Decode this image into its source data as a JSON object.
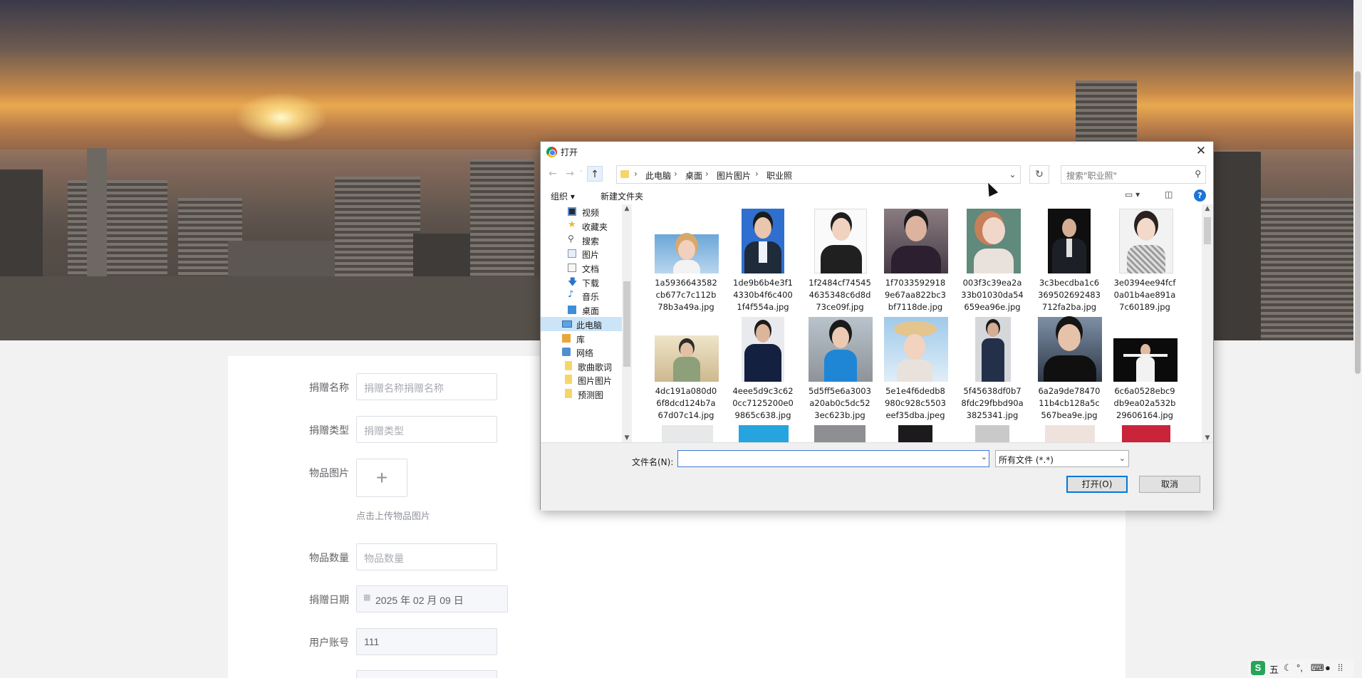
{
  "form": {
    "donation_name": {
      "label": "捐赠名称",
      "placeholder": "捐赠名称捐赠名称"
    },
    "donation_type": {
      "label": "捐赠类型",
      "placeholder": "捐赠类型"
    },
    "item_image": {
      "label": "物品图片",
      "hint": "点击上传物品图片",
      "plus": "+"
    },
    "item_quantity": {
      "label": "物品数量",
      "placeholder": "物品数量"
    },
    "donation_date": {
      "label": "捐赠日期",
      "value": "2025 年 02 月 09 日"
    },
    "user_account": {
      "label": "用户账号",
      "value": "111"
    }
  },
  "dialog": {
    "title": "打开",
    "close": "✕",
    "breadcrumb": [
      "此电脑",
      "桌面",
      "图片图片",
      "职业照"
    ],
    "search_placeholder": "搜索\"职业照\"",
    "toolbar": {
      "organize": "组织 ▾",
      "new_folder": "新建文件夹"
    },
    "tree": [
      {
        "label": "视频",
        "icon": "video-icon"
      },
      {
        "label": "收藏夹",
        "icon": "star-icon"
      },
      {
        "label": "搜索",
        "icon": "search-icon"
      },
      {
        "label": "图片",
        "icon": "picture-icon"
      },
      {
        "label": "文档",
        "icon": "document-icon"
      },
      {
        "label": "下载",
        "icon": "download-icon"
      },
      {
        "label": "音乐",
        "icon": "music-icon"
      },
      {
        "label": "桌面",
        "icon": "desktop-icon"
      },
      {
        "label": "此电脑",
        "icon": "computer-icon"
      },
      {
        "label": "库",
        "icon": "library-icon"
      },
      {
        "label": "网络",
        "icon": "network-icon"
      },
      {
        "label": "歌曲歌词",
        "icon": "folder-icon"
      },
      {
        "label": "图片图片",
        "icon": "folder-icon"
      },
      {
        "label": "预测图",
        "icon": "folder-icon"
      }
    ],
    "files": [
      "1a5936643582cb677c7c112b78b3a49a.jpg",
      "1de9b6b4e3f14330b4f6c4001f4f554a.jpg",
      "1f2484cf745454635348c6d8d73ce09f.jpg",
      "1f70335929189e67aa822bc3bf7118de.jpg",
      "003f3c39ea2a33b01030da54659ea96e.jpg",
      "3c3becdba1c6369502692483712fa2ba.jpg",
      "3e0394ee94fcf0a01b4ae891a7c60189.jpg",
      "4dc191a080d06f8dcd124b7a67d07c14.jpg",
      "4eee5d9c3c620cc7125200e09865c638.jpg",
      "5d5ff5e6a3003a20ab0c5dc523ec623b.jpg",
      "5e1e4f6dedb8980c928c5503eef35dba.jpeg",
      "5f45638df0b78fdc29fbbd90a3825341.jpg",
      "6a2a9de7847011b4cb128a5c567bea9e.jpg",
      "6c6a0528ebc9db9ea02a532b29606164.jpg"
    ],
    "filename_label": "文件名(N):",
    "filename_value": "",
    "filter_value": "所有文件 (*.*)",
    "open_button": "打开(O)",
    "cancel_button": "取消"
  },
  "ime": {
    "mode": "五"
  },
  "colors": {
    "dialog_primary": "#0078d7",
    "selection": "#cce4f7",
    "help": "#1c74d6"
  }
}
